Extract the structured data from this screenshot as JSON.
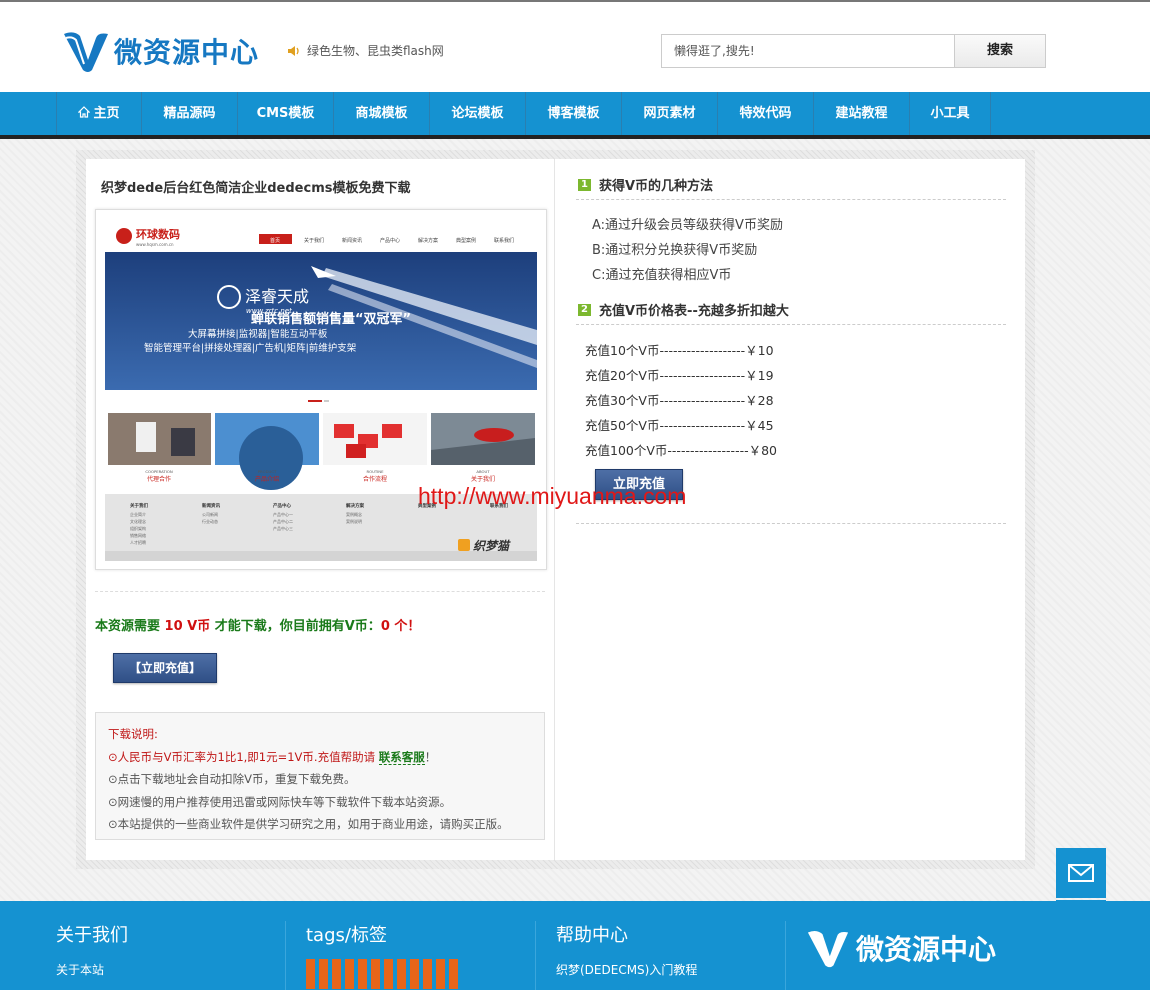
{
  "header": {
    "site_name": "微资源中心",
    "notice": "绿色生物、昆虫类flash网",
    "search_placeholder": "懒得逛了,搜先!",
    "search_button": "搜索"
  },
  "nav": {
    "items": [
      "主页",
      "精品源码",
      "CMS模板",
      "商城模板",
      "论坛模板",
      "博客模板",
      "网页素材",
      "特效代码",
      "建站教程",
      "小工具"
    ]
  },
  "article": {
    "title": "织梦dede后台红色简洁企业dedecms模板免费下载",
    "need_prefix": "本资源需要 ",
    "need_amount": "10 V币",
    "need_middle": " 才能下载，你目前拥有V币：",
    "need_own": "0 个",
    "need_suffix": "！",
    "recharge_button": "【立即充值】"
  },
  "preview": {
    "logo_text": "环球数码",
    "logo_sub": "www.hqsm.com.cn",
    "menu": [
      "首页",
      "关于我们",
      "新闻资讯",
      "产品中心",
      "解决方案",
      "典型案例",
      "联系我们"
    ],
    "banner_brand": "泽睿天成",
    "banner_url": "www.zrtc.net",
    "banner_headline": "蝉联销售额销售量“双冠军”",
    "banner_line2": "大屏幕拼接|监视器|智能互动平板",
    "banner_line3": "智能管理平台|拼接处理器|广告机|矩阵|前维护支架",
    "thumbs": [
      {
        "en": "COOPERATION",
        "cn": "代理合作"
      },
      {
        "en": "PRODUCT",
        "cn": "产品介绍"
      },
      {
        "en": "ROUTINE",
        "cn": "合作流程"
      },
      {
        "en": "ABOUT",
        "cn": "关于我们"
      }
    ],
    "footer_cols": [
      {
        "title": "关于我们",
        "items": [
          "企业简介",
          "文化理念",
          "组织架构",
          "销售网络",
          "人才招聘"
        ]
      },
      {
        "title": "新闻资讯",
        "items": [
          "公司新闻",
          "行业动态"
        ]
      },
      {
        "title": "产品中心",
        "items": [
          "产品中心一",
          "产品中心二",
          "产品中心三"
        ]
      },
      {
        "title": "解决方案",
        "items": [
          "案例概念",
          "案例说明"
        ]
      },
      {
        "title": "典型案例",
        "items": []
      },
      {
        "title": "联系我们",
        "items": []
      }
    ],
    "stamp": "织梦猫"
  },
  "download_notes": {
    "heading": "下载说明:",
    "line1_prefix": "⊙人民币与V币汇率为1比1,即1元=1V币.充值帮助请 ",
    "line1_link": "联系客服",
    "line1_suffix": "！",
    "line2": "⊙点击下载地址会自动扣除V币，重复下载免费。",
    "line3": "⊙网速慢的用户推荐使用迅雷或网际快车等下载软件下载本站资源。",
    "line4": "⊙本站提供的一些商业软件是供学习研究之用，如用于商业用途，请购买正版。"
  },
  "sidebar": {
    "section1_num": "1",
    "section1_title": "获得V币的几种方法",
    "methods": [
      "A:通过升级会员等级获得V币奖励",
      "B:通过积分兑换获得V币奖励",
      "C:通过充值获得相应V币"
    ],
    "section2_num": "2",
    "section2_title": "充值V币价格表--充越多折扣越大",
    "prices": [
      "充值10个V币-------------------￥10",
      "充值20个V币-------------------￥19",
      "充值30个V币-------------------￥28",
      "充值50个V币-------------------￥45",
      "充值100个V币------------------￥80"
    ],
    "recharge_button": "立即充值"
  },
  "watermark": "http://www.miyuanma.com",
  "footer": {
    "col1_title": "关于我们",
    "col1_link": "关于本站",
    "col2_title": "tags/标签",
    "col3_title": "帮助中心",
    "col3_link": "织梦(DEDECMS)入门教程",
    "logo_text": "微资源中心"
  },
  "colors": {
    "nav_blue": "#1592d1",
    "logo_blue": "#1678c2",
    "link_green": "#1a7a1a",
    "alert_red": "#d01010",
    "tag_orange": "#e8651a"
  }
}
